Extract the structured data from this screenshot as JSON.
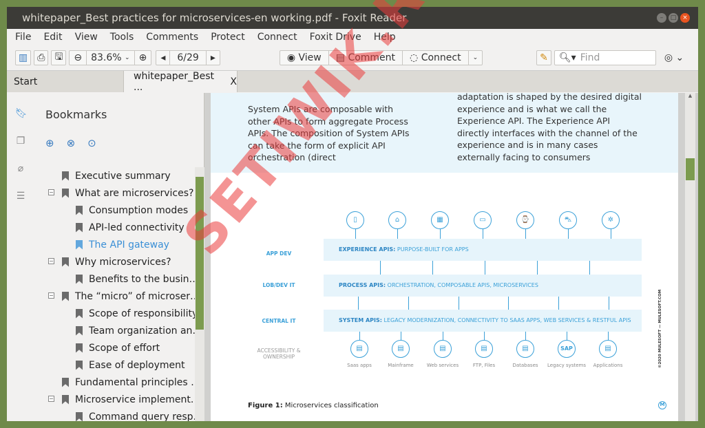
{
  "window": {
    "title": "whitepaper_Best practices for microservices-en working.pdf - Foxit Reader"
  },
  "menu": [
    "File",
    "Edit",
    "View",
    "Tools",
    "Comments",
    "Protect",
    "Connect",
    "Foxit Drive",
    "Help"
  ],
  "toolbar": {
    "zoom": "83.6%",
    "page": "6/29",
    "view": "View",
    "comment": "Comment",
    "connect": "Connect",
    "find_placeholder": "Find"
  },
  "tabs": {
    "start": "Start",
    "doc": "whitepaper_Best ...",
    "close": "X"
  },
  "bookmarks": {
    "title": "Bookmarks",
    "items": [
      {
        "label": "Executive summary",
        "level": 0
      },
      {
        "label": "What are microservices?",
        "level": 0,
        "expand": "−"
      },
      {
        "label": "Consumption modes",
        "level": 1
      },
      {
        "label": "API-led connectivity",
        "level": 1
      },
      {
        "label": "The API gateway",
        "level": 1,
        "selected": true
      },
      {
        "label": "Why microservices?",
        "level": 0,
        "expand": "−"
      },
      {
        "label": "Benefits to the busin…",
        "level": 1
      },
      {
        "label": "The “micro” of microser…",
        "level": 0,
        "expand": "−"
      },
      {
        "label": "Scope of responsibility",
        "level": 1
      },
      {
        "label": "Team organization an…",
        "level": 1
      },
      {
        "label": "Scope of effort",
        "level": 1
      },
      {
        "label": "Ease of deployment",
        "level": 1
      },
      {
        "label": "Fundamental principles …",
        "level": 0
      },
      {
        "label": "Microservice implement…",
        "level": 0,
        "expand": "−"
      },
      {
        "label": "Command query resp…",
        "level": 1
      }
    ]
  },
  "page": {
    "left_text": "System APIs are composable with other APIs to form aggregate Process APIs. The composition of System APIs can take the form of explicit API orchestration (direct",
    "right_text": "adaptation is shaped by the desired digital experience and is what we call the Experience API. The Experience API directly interfaces with the channel of the experience and is in many cases externally facing to consumers",
    "diagram": {
      "left_labels": [
        "APP DEV",
        "LOB/DEV IT",
        "CENTRAL IT",
        "ACCESSIBILITY & OWNERSHIP"
      ],
      "rows": [
        {
          "bold": "EXPERIENCE APIS:",
          "text": " PURPOSE-BUILT FOR APPS"
        },
        {
          "bold": "PROCESS APIS:",
          "text": " ORCHESTRATION, COMPOSABLE APIS, MICROSERVICES"
        },
        {
          "bold": "SYSTEM APIS:",
          "text": " LEGACY MODERNIZATION, CONNECTIVITY TO SAAS APPS, WEB SERVICES & RESTFUL APIS"
        }
      ],
      "top_icons": [
        "mobile-icon",
        "store-icon",
        "building-icon",
        "monitor-icon",
        "watch-icon",
        "car-icon",
        "iot-icon"
      ],
      "bottom": [
        {
          "label": "Saas apps"
        },
        {
          "label": "Mainframe"
        },
        {
          "label": "Web services"
        },
        {
          "label": "FTP, Files"
        },
        {
          "label": "Databases"
        },
        {
          "label": "Legacy systems",
          "glyph": "SAP"
        },
        {
          "label": "Applications"
        }
      ],
      "copyright": "©2020 MULESOFT — MULESOFT.COM"
    },
    "figure_bold": "Figure 1:",
    "figure_text": " Microservices classification"
  },
  "watermark": "SETIWIK.RU",
  "colors": {
    "accent": "#3aa0d8",
    "scroll_thumb": "#7c9b4f",
    "titlebar": "#3c3b37"
  }
}
